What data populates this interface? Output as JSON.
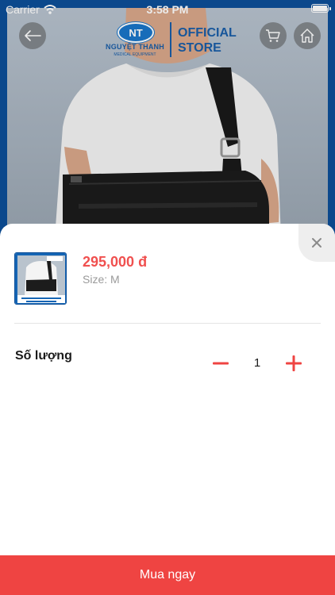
{
  "status_bar": {
    "carrier": "Carrier",
    "time": "3:58 PM"
  },
  "nav": {
    "back_icon": "arrow-left-icon",
    "cart_icon": "cart-icon",
    "home_icon": "home-icon"
  },
  "brand": {
    "badge": "NT",
    "name": "NGUYỆT THANH",
    "subtitle": "MEDICAL EQUIPMENT",
    "store_line1": "OFFICIAL",
    "store_line2": "STORE"
  },
  "sheet": {
    "price": "295,000 đ",
    "size": "Size: M",
    "quantity_label": "Số lượng",
    "quantity_value": "1",
    "buy_button": "Mua ngay",
    "close_icon": "close-icon"
  },
  "colors": {
    "accent": "#ef4442",
    "price": "#f0504f",
    "brand": "#1a5ea8"
  }
}
